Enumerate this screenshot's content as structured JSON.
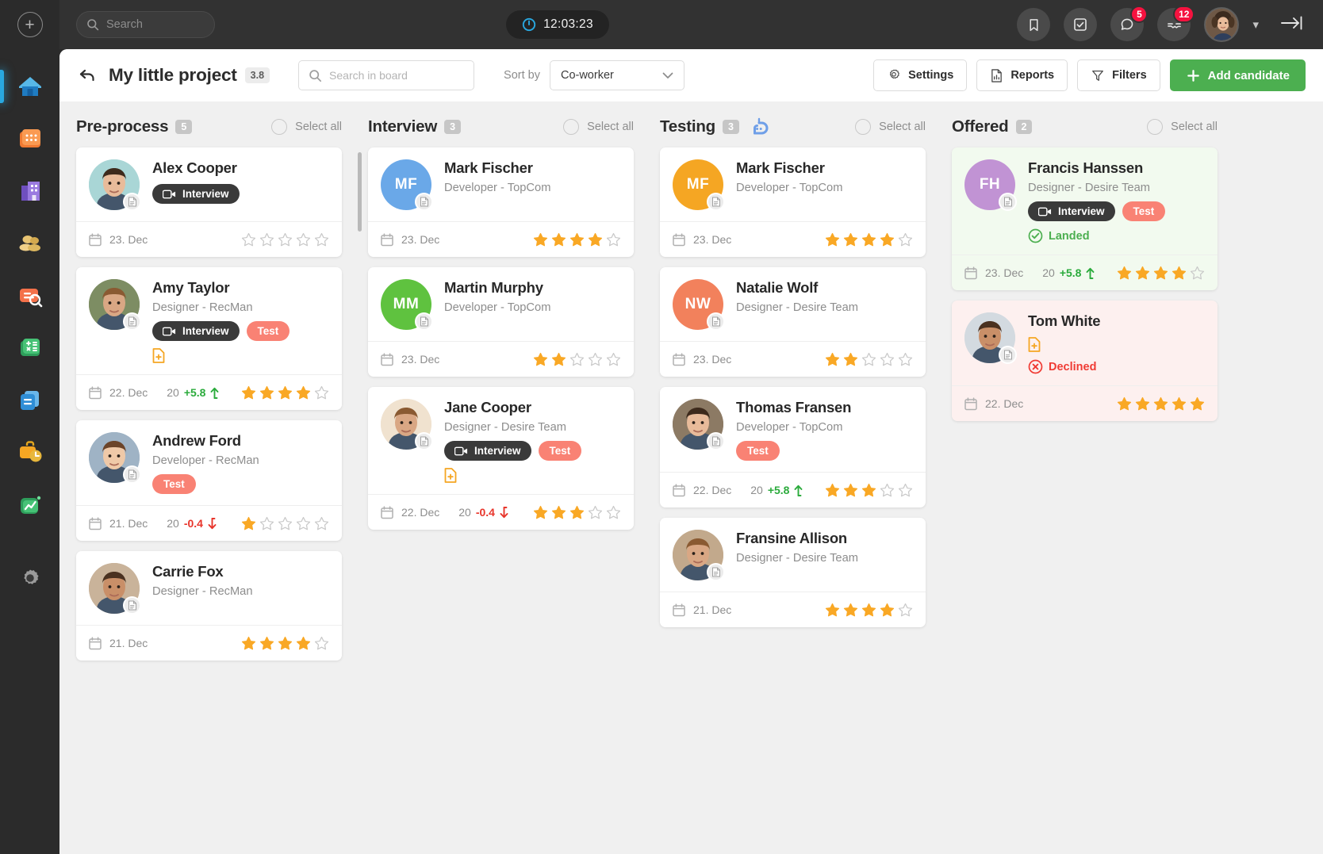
{
  "topbar": {
    "add_icon": "plus-circle-icon",
    "search_placeholder": "Search",
    "clock_icon": "clock-icon",
    "time": "12:03:23",
    "bookmark_icon": "bookmark-icon",
    "tasks_icon": "checkbox-icon",
    "messages_icon": "chat-bubble-icon",
    "messages_badge": "5",
    "notifications_icon": "handshake-icon",
    "notifications_badge": "12",
    "avatar_label": "user-avatar",
    "chevron_icon": "chevron-down-icon",
    "collapse_icon": "collapse-right-icon"
  },
  "sidebar": {
    "items": [
      {
        "name": "home",
        "icon": "home-icon",
        "active": true
      },
      {
        "name": "calendar",
        "icon": "calendar-icon",
        "active": false
      },
      {
        "name": "company",
        "icon": "building-icon",
        "active": false
      },
      {
        "name": "people",
        "icon": "people-icon",
        "active": false
      },
      {
        "name": "candidate-search",
        "icon": "candidate-search-icon",
        "active": false
      },
      {
        "name": "payroll",
        "icon": "calculator-icon",
        "active": false
      },
      {
        "name": "documents",
        "icon": "document-icon",
        "active": false
      },
      {
        "name": "timesheet",
        "icon": "briefcase-clock-icon",
        "active": false
      },
      {
        "name": "analytics",
        "icon": "chart-icon",
        "active": false
      },
      {
        "name": "settings",
        "icon": "gear-icon",
        "active": false
      }
    ]
  },
  "header": {
    "back_icon": "back-arrow-icon",
    "title": "My little project",
    "rating_badge": "3.8",
    "search_icon": "search-icon",
    "search_placeholder": "Search in board",
    "sort_by_label": "Sort by",
    "sort_value": "Co-worker",
    "sort_chevron": "chevron-down-icon",
    "settings_label": "Settings",
    "settings_icon": "gear-icon",
    "reports_label": "Reports",
    "reports_icon": "report-document-icon",
    "filters_label": "Filters",
    "filters_icon": "funnel-icon",
    "add_candidate_label": "Add candidate",
    "add_candidate_icon": "plus-icon",
    "accent_green": "#4caf50"
  },
  "board": {
    "select_all_label": "Select all",
    "columns": [
      {
        "title": "Pre-process",
        "count": "5",
        "bot_icon": null,
        "cards": [
          {
            "name": "Alex Cooper",
            "role": "",
            "avatar_type": "photo",
            "avatar_initials": "",
            "avatar_color": "#a9d6d6",
            "tags": [
              {
                "type": "dark",
                "label": "Interview",
                "icon": "video-camera-icon"
              }
            ],
            "has_doc_plus": false,
            "status": null,
            "date": "23. Dec",
            "score_base": "",
            "score_delta": "",
            "score_dir": "",
            "rating": 0,
            "highlight": ""
          },
          {
            "name": "Amy Taylor",
            "role": "Designer - RecMan",
            "avatar_type": "photo",
            "avatar_initials": "",
            "avatar_color": "#7d8d63",
            "tags": [
              {
                "type": "dark",
                "label": "Interview",
                "icon": "video-camera-icon"
              },
              {
                "type": "red",
                "label": "Test",
                "icon": null
              }
            ],
            "has_doc_plus": true,
            "status": null,
            "date": "22. Dec",
            "score_base": "20",
            "score_delta": "+5.8",
            "score_dir": "up",
            "rating": 4,
            "highlight": ""
          },
          {
            "name": "Andrew Ford",
            "role": "Developer - RecMan",
            "avatar_type": "photo",
            "avatar_initials": "",
            "avatar_color": "#9fb3c5",
            "tags": [
              {
                "type": "red",
                "label": "Test",
                "icon": null
              }
            ],
            "has_doc_plus": false,
            "status": null,
            "date": "21. Dec",
            "score_base": "20",
            "score_delta": "-0.4",
            "score_dir": "down",
            "rating": 1,
            "highlight": ""
          },
          {
            "name": "Carrie Fox",
            "role": "Designer - RecMan",
            "avatar_type": "photo",
            "avatar_initials": "",
            "avatar_color": "#c9b39a",
            "tags": [],
            "has_doc_plus": false,
            "status": null,
            "date": "21. Dec",
            "score_base": "",
            "score_delta": "",
            "score_dir": "",
            "rating": 4,
            "highlight": ""
          }
        ]
      },
      {
        "title": "Interview",
        "count": "3",
        "bot_icon": null,
        "cards": [
          {
            "name": "Mark Fischer",
            "role": "Developer - TopCom",
            "avatar_type": "initials",
            "avatar_initials": "MF",
            "avatar_color": "#6aa8e8",
            "tags": [],
            "has_doc_plus": false,
            "status": null,
            "date": "23. Dec",
            "score_base": "",
            "score_delta": "",
            "score_dir": "",
            "rating": 4,
            "highlight": ""
          },
          {
            "name": "Martin Murphy",
            "role": "Developer - TopCom",
            "avatar_type": "initials",
            "avatar_initials": "MM",
            "avatar_color": "#5fc23f",
            "tags": [],
            "has_doc_plus": false,
            "status": null,
            "date": "23. Dec",
            "score_base": "",
            "score_delta": "",
            "score_dir": "",
            "rating": 2,
            "highlight": ""
          },
          {
            "name": "Jane Cooper",
            "role": "Designer - Desire Team",
            "avatar_type": "photo",
            "avatar_initials": "",
            "avatar_color": "#f0e2cf",
            "tags": [
              {
                "type": "dark",
                "label": "Interview",
                "icon": "video-camera-icon"
              },
              {
                "type": "red",
                "label": "Test",
                "icon": null
              }
            ],
            "has_doc_plus": true,
            "status": null,
            "date": "22. Dec",
            "score_base": "20",
            "score_delta": "-0.4",
            "score_dir": "down",
            "rating": 3,
            "highlight": ""
          }
        ]
      },
      {
        "title": "Testing",
        "count": "3",
        "bot_icon": "robot-icon",
        "cards": [
          {
            "name": "Mark Fischer",
            "role": "Developer - TopCom",
            "avatar_type": "initials",
            "avatar_initials": "MF",
            "avatar_color": "#f5a623",
            "tags": [],
            "has_doc_plus": false,
            "status": null,
            "date": "23. Dec",
            "score_base": "",
            "score_delta": "",
            "score_dir": "",
            "rating": 4,
            "highlight": ""
          },
          {
            "name": "Natalie Wolf",
            "role": "Designer - Desire Team",
            "avatar_type": "initials",
            "avatar_initials": "NW",
            "avatar_color": "#f2815c",
            "tags": [],
            "has_doc_plus": false,
            "status": null,
            "date": "23. Dec",
            "score_base": "",
            "score_delta": "",
            "score_dir": "",
            "rating": 2,
            "highlight": ""
          },
          {
            "name": "Thomas Fransen",
            "role": "Developer - TopCom",
            "avatar_type": "photo",
            "avatar_initials": "",
            "avatar_color": "#8c7a64",
            "tags": [
              {
                "type": "red",
                "label": "Test",
                "icon": null
              }
            ],
            "has_doc_plus": false,
            "status": null,
            "date": "22. Dec",
            "score_base": "20",
            "score_delta": "+5.8",
            "score_dir": "up",
            "rating": 3,
            "highlight": ""
          },
          {
            "name": "Fransine Allison",
            "role": "Designer - Desire Team",
            "avatar_type": "photo",
            "avatar_initials": "",
            "avatar_color": "#c2a98c",
            "tags": [],
            "has_doc_plus": false,
            "status": null,
            "date": "21. Dec",
            "score_base": "",
            "score_delta": "",
            "score_dir": "",
            "rating": 4,
            "highlight": ""
          }
        ]
      },
      {
        "title": "Offered",
        "count": "2",
        "bot_icon": null,
        "cards": [
          {
            "name": "Francis Hanssen",
            "role": "Designer - Desire Team",
            "avatar_type": "initials",
            "avatar_initials": "FH",
            "avatar_color": "#c193d4",
            "tags": [
              {
                "type": "dark",
                "label": "Interview",
                "icon": "video-camera-icon"
              },
              {
                "type": "red",
                "label": "Test",
                "icon": null
              }
            ],
            "has_doc_plus": false,
            "status": {
              "kind": "landed",
              "label": "Landed",
              "icon": "check-circle-icon"
            },
            "date": "23. Dec",
            "score_base": "20",
            "score_delta": "+5.8",
            "score_dir": "up",
            "rating": 4,
            "highlight": "landed"
          },
          {
            "name": "Tom White",
            "role": "",
            "avatar_type": "photo",
            "avatar_initials": "",
            "avatar_color": "#d3dae0",
            "tags": [],
            "has_doc_plus": true,
            "status": {
              "kind": "declined",
              "label": "Declined",
              "icon": "x-circle-icon"
            },
            "date": "22. Dec",
            "score_base": "",
            "score_delta": "",
            "score_dir": "",
            "rating": 5,
            "highlight": "declined"
          }
        ]
      }
    ]
  }
}
